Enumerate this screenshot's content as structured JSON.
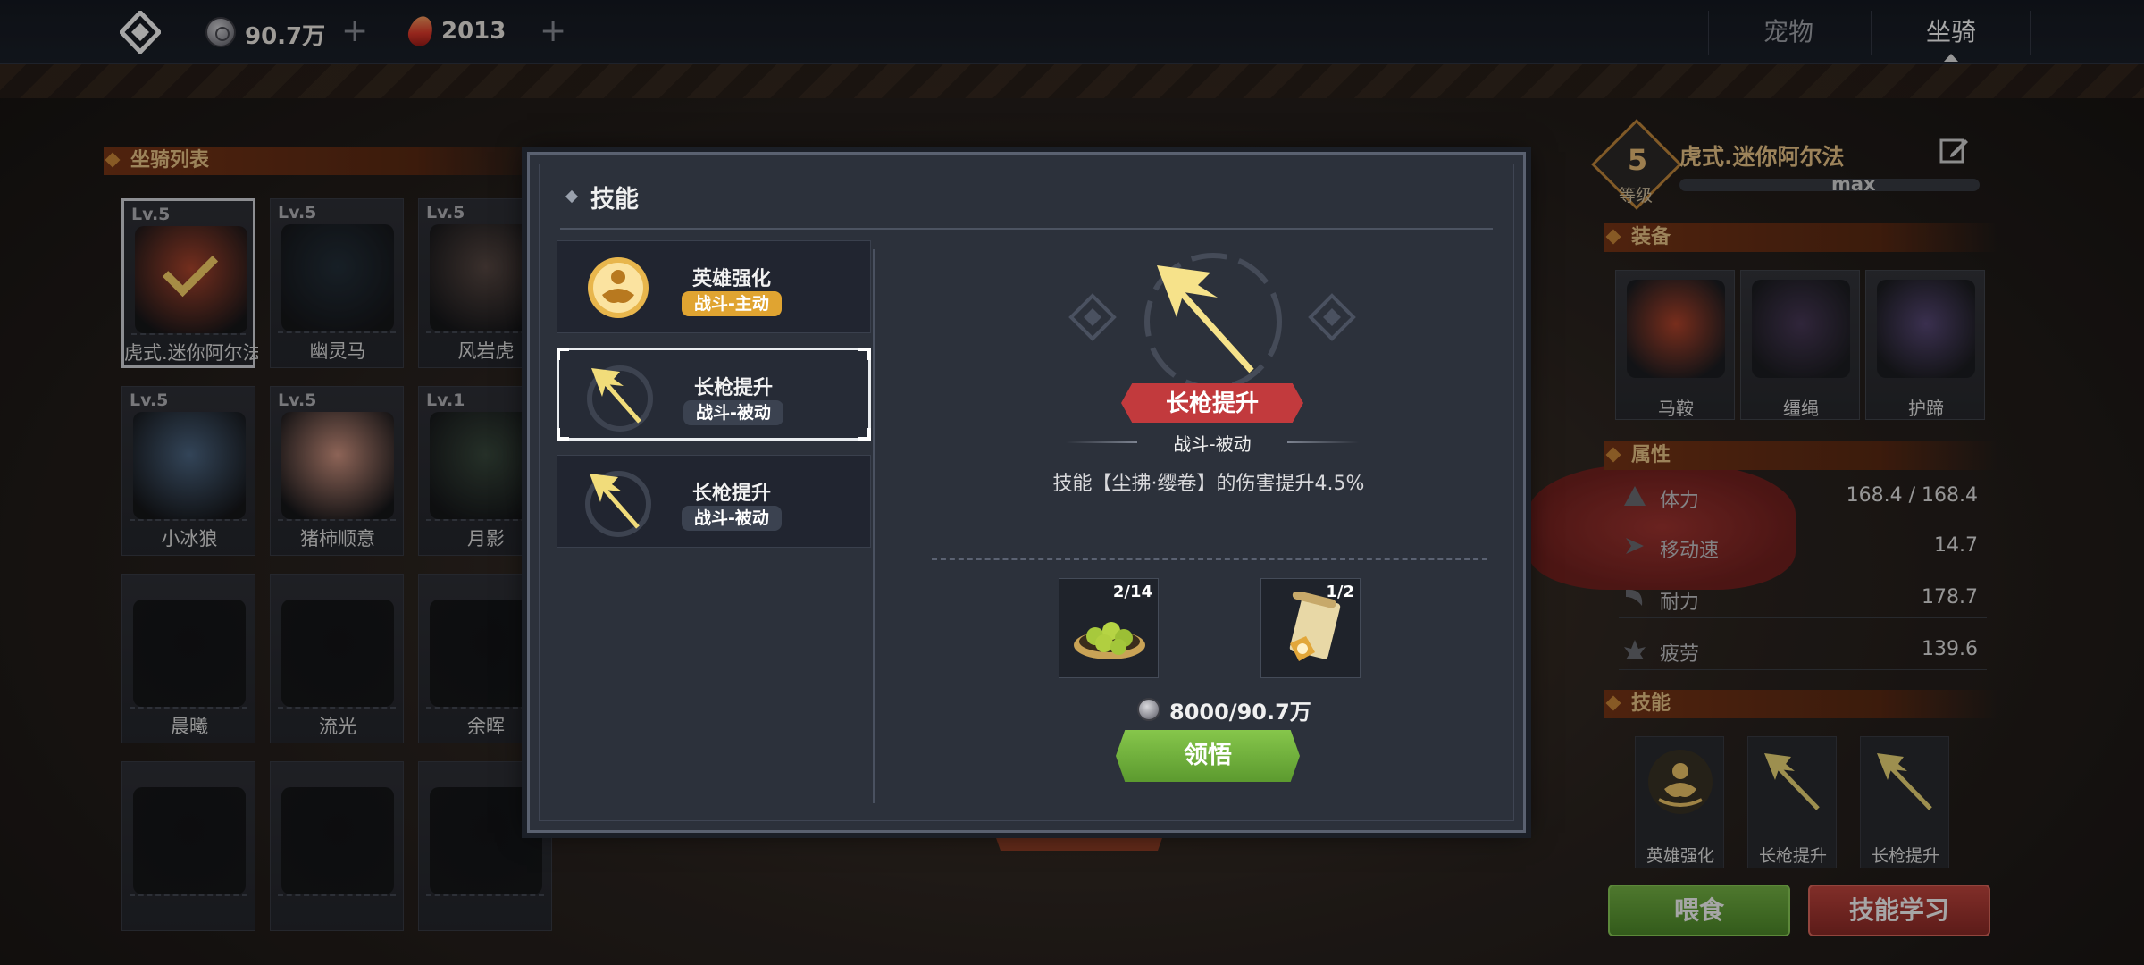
{
  "currency": {
    "silver_amount": "90.7万",
    "gem_amount": "2013",
    "plus_symbol": "+"
  },
  "tabs": [
    {
      "label": "宠物",
      "active": false
    },
    {
      "label": "坐骑",
      "active": true
    }
  ],
  "mount_list": {
    "title": "坐骑列表",
    "items": [
      {
        "level": "Lv.5",
        "name": "虎式.迷你阿尔法",
        "selected": true,
        "color": "#b2472e"
      },
      {
        "level": "Lv.5",
        "name": "幽灵马",
        "selected": false,
        "color": "#24303b"
      },
      {
        "level": "Lv.5",
        "name": "风岩虎",
        "selected": false,
        "color": "#5a4a45"
      },
      {
        "level": "Lv.5",
        "name": "小冰狼",
        "selected": false,
        "color": "#4f6a88"
      },
      {
        "level": "Lv.5",
        "name": "猪柿顺意",
        "selected": false,
        "color": "#d99a86"
      },
      {
        "level": "Lv.1",
        "name": "月影",
        "selected": false,
        "color": "#3a4a3e"
      },
      {
        "level": "",
        "name": "晨曦",
        "selected": false,
        "color": "#141518"
      },
      {
        "level": "",
        "name": "流光",
        "selected": false,
        "color": "#141518"
      },
      {
        "level": "",
        "name": "余晖",
        "selected": false,
        "color": "#141518"
      },
      {
        "level": "",
        "name": "",
        "selected": false,
        "color": "#141518"
      },
      {
        "level": "",
        "name": "",
        "selected": false,
        "color": "#141518"
      },
      {
        "level": "",
        "name": "",
        "selected": false,
        "color": "#141518"
      }
    ]
  },
  "mount_detail": {
    "level": "5",
    "level_label": "等级",
    "name": "虎式.迷你阿尔法",
    "exp_text": "max",
    "equipment_title": "装备",
    "equipment": [
      {
        "name": "马鞍",
        "color": "#b8462c"
      },
      {
        "name": "缰绳",
        "color": "#4a3a5a"
      },
      {
        "name": "护蹄",
        "color": "#5a4a7a"
      }
    ],
    "attributes_title": "属性",
    "attributes": [
      {
        "name": "体力",
        "value": "168.4 / 168.4",
        "icon": "health-icon"
      },
      {
        "name": "移动速",
        "value": "14.7",
        "icon": "speed-icon"
      },
      {
        "name": "耐力",
        "value": "178.7",
        "icon": "stamina-icon"
      },
      {
        "name": "疲劳",
        "value": "139.6",
        "icon": "fatigue-icon"
      }
    ],
    "skills_title": "技能",
    "skills": [
      {
        "name": "英雄强化",
        "icon": "hero-buff-icon"
      },
      {
        "name": "长枪提升",
        "icon": "spear-icon"
      },
      {
        "name": "长枪提升",
        "icon": "spear-icon"
      }
    ],
    "feed_button": "喂食",
    "skill_learn_button": "技能学习"
  },
  "skill_modal": {
    "title": "技能",
    "skill_list": [
      {
        "name": "英雄强化",
        "tag": "战斗-主动",
        "active_type": true,
        "selected": false,
        "icon": "hero-buff-icon"
      },
      {
        "name": "长枪提升",
        "tag": "战斗-被动",
        "active_type": false,
        "selected": true,
        "icon": "spear-icon"
      },
      {
        "name": "长枪提升",
        "tag": "战斗-被动",
        "active_type": false,
        "selected": false,
        "icon": "spear-icon"
      }
    ],
    "detail": {
      "name": "长枪提升",
      "type": "战斗-被动",
      "description": "技能【尘拂·缨卷】的伤害提升4.5%",
      "materials": [
        {
          "count": "2/14",
          "icon": "green-fruit-plate-icon"
        },
        {
          "count": "1/2",
          "icon": "skill-scroll-icon"
        }
      ],
      "cost": "8000/90.7万",
      "comprehend_button": "领悟"
    }
  }
}
